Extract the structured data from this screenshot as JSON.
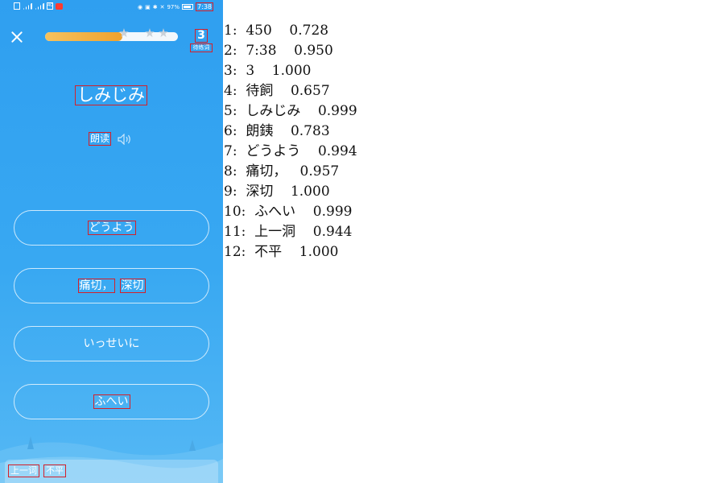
{
  "status_bar": {
    "network_label": "4G",
    "battery_percent": "97%",
    "time": "7:38"
  },
  "progress": {
    "value": 0.58,
    "stars_total": 3
  },
  "counter": {
    "number": "3",
    "label": "待练词"
  },
  "word": "しみじみ",
  "read_aloud_label": "朗读",
  "options": [
    {
      "parts": [
        "どうよう"
      ],
      "boxed": true
    },
    {
      "parts": [
        "痛切，",
        "深切"
      ],
      "boxed": true
    },
    {
      "parts": [
        "いっせいに"
      ],
      "boxed": false
    },
    {
      "parts": [
        "ふへい"
      ],
      "boxed": true
    }
  ],
  "bottom_bar": {
    "prev_label": "上一词",
    "value": "不平"
  },
  "ocr_results": [
    "1:  450    0.728",
    "2:  7:38    0.950",
    "3:  3    1.000",
    "4:  待飼    0.657",
    "5:  しみじみ    0.999",
    "6:  朗銕    0.783",
    "7:  どうよう    0.994",
    "8:  痛切，   0.957",
    "9:  深切    1.000",
    "10:  ふへい    0.999",
    "11:  上一洞    0.944",
    "12:  不平    1.000"
  ],
  "colors": {
    "phone_bg": "#38a8f2",
    "progress_fill": "#f0a22d",
    "box_outline": "#d4202a"
  }
}
